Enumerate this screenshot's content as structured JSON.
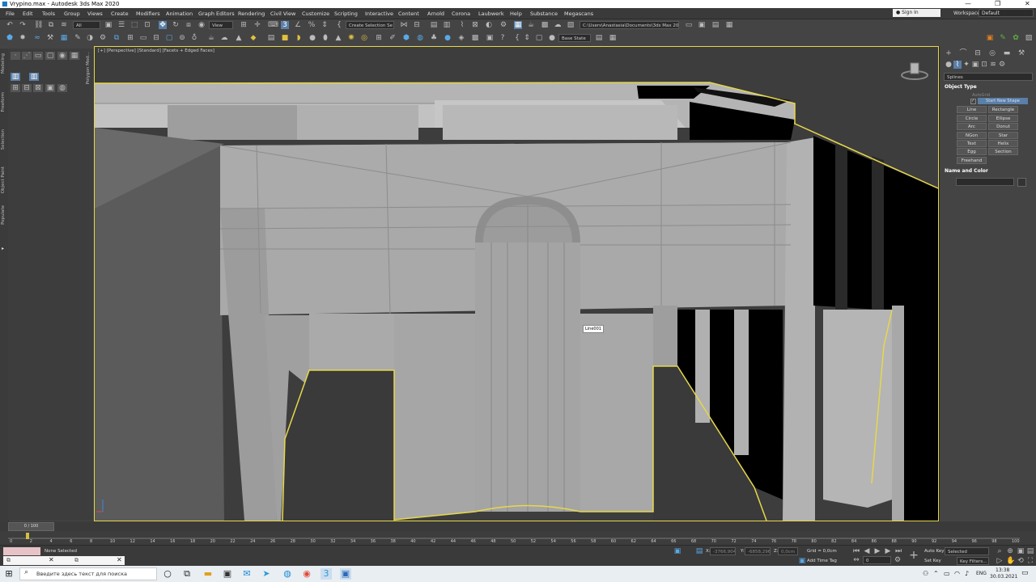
{
  "window": {
    "title": "Vrypino.max - Autodesk 3ds Max 2020",
    "minimize": "—",
    "maximize": "❐",
    "close": "✕"
  },
  "menu": {
    "items": [
      "File",
      "Edit",
      "Tools",
      "Group",
      "Views",
      "Create",
      "Modifiers",
      "Animation",
      "Graph Editors",
      "Rendering",
      "Civil View",
      "Customize",
      "Scripting",
      "Interactive",
      "Content",
      "Arnold",
      "Corona",
      "Laubwerk",
      "Help",
      "Substance",
      "Megascans"
    ],
    "sign_in": "Sign In",
    "workspaces_label": "Workspaces:",
    "workspace": "Default"
  },
  "toolbar": {
    "filter": "All",
    "view": "View",
    "create_selection_set": "Create Selection Se",
    "project_path": "C:\\Users\\Anastasia\\Documents\\3ds Max 2020",
    "base_state": "Base State"
  },
  "ribbon": {
    "tabs": [
      "Modeling",
      "Freeform",
      "Selection",
      "Object Paint",
      "Populate"
    ],
    "panel_title": "Polygon Mod..."
  },
  "viewport": {
    "label": "[+] [Perspective] [Standard] [Facets + Edged Faces]",
    "tooltip": "Line001",
    "gizmo_label": "z"
  },
  "command_panel": {
    "category": "Splines",
    "object_type_title": "Object Type",
    "autogrid": "AutoGrid",
    "start_new_shape": "Start New Shape",
    "buttons": [
      "Line",
      "Rectangle",
      "Circle",
      "Ellipse",
      "Arc",
      "Donut",
      "NGon",
      "Star",
      "Text",
      "Helix",
      "Egg",
      "Section",
      "Freehand"
    ],
    "name_color_title": "Name and Color"
  },
  "timeline": {
    "frame_display": "0 / 100",
    "ticks": [
      "0",
      "2",
      "4",
      "6",
      "8",
      "10",
      "12",
      "14",
      "16",
      "18",
      "20",
      "22",
      "24",
      "26",
      "28",
      "30",
      "32",
      "34",
      "36",
      "38",
      "40",
      "42",
      "44",
      "46",
      "48",
      "50",
      "52",
      "54",
      "56",
      "58",
      "60",
      "62",
      "64",
      "66",
      "68",
      "70",
      "72",
      "74",
      "76",
      "78",
      "80",
      "82",
      "84",
      "86",
      "88",
      "90",
      "92",
      "94",
      "96",
      "98",
      "100"
    ]
  },
  "status": {
    "selection": "None Selected",
    "x_label": "X:",
    "x_value": "-3766,904m",
    "y_label": "Y:",
    "y_value": "-6858,296",
    "z_label": "Z:",
    "z_value": "0,0cm",
    "grid": "Grid = 0,0cm",
    "add_time_tag": "Add Time Tag",
    "auto_key": "Auto Key",
    "set_key": "Set Key",
    "selected": "Selected",
    "key_filters": "Key Filters...",
    "frame": "0"
  },
  "taskbar": {
    "search_placeholder": "Введите здесь текст для поиска",
    "lang": "ENG",
    "time": "13:38",
    "date": "30.03.2021"
  }
}
